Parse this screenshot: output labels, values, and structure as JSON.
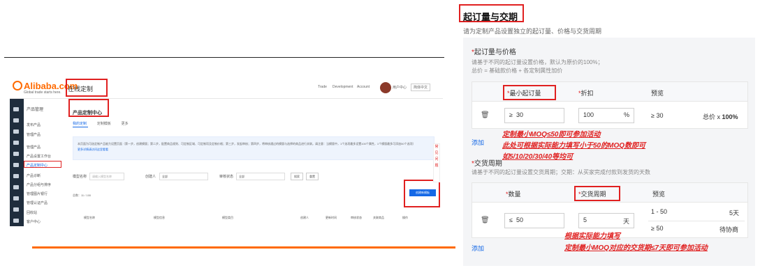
{
  "left": {
    "logo": "Alibaba.com",
    "logo_tagline": "Global trade starts here.",
    "online_custom_title": "在线定制",
    "top_nav": [
      "Trade",
      "Development",
      "Account"
    ],
    "avatar_label": "用户中心",
    "language": "简体中文",
    "menu": [
      "产品管理",
      "发布产品",
      "管理产品",
      "管理产品",
      "产品设置工作台",
      "产品定制中心",
      "产品诊断",
      "产品分组与排序",
      "管理图片银行",
      "管理认证产品",
      "回收站",
      "客户中心"
    ],
    "page_title": "产品定制中心",
    "tabs": [
      "我的定制",
      "定制模板",
      "更多"
    ],
    "info_text": "本页面为可选定制产品能力设置页面（第一步，创建模版；第二步，配置商品规则、可定制区域、可定制项及定制价格；第三步，发起审核；第四步，将审核通过的模版与选择的商品进行关联。请注意：当模版中，1个选项最多设置100个属性，1个模版最多可添加50个选项）",
    "info_link": "更多详情请访问这里看看",
    "filters": {
      "name_label": "模型名称",
      "name_placeholder": "请输入模型名称",
      "creator_label": "创建人",
      "creator_value": "全部",
      "status_label": "审核状态",
      "status_value": "全部",
      "search_button": "搜索",
      "reset_button": "重置"
    },
    "count": "总数：11 / 100",
    "create_button": "创建新模板",
    "table_headers": [
      "模型名称",
      "模型信息",
      "模型类目",
      "创建人",
      "更新时间",
      "审核状态",
      "关联商品",
      "操作"
    ],
    "side_float": [
      "常",
      "见",
      "问",
      "题"
    ]
  },
  "right": {
    "title": "起订量与交期",
    "subtitle": "请为定制产品设置独立的起订量、价格与交货周期",
    "moq_section": {
      "title": "起订量与价格",
      "hint_line1": "请基于不同的起订量设置价格，默认为原价的100%；",
      "hint_line2": "总价 = 基础款价格 + 各定制属性加价",
      "headers": [
        "最小起订量",
        "折扣",
        "预览"
      ],
      "row": {
        "prefix": "≥",
        "moq_value": "30",
        "discount_value": "100",
        "discount_suffix": "%",
        "preview_left": "≥ 30",
        "preview_right_prefix": "总价 x ",
        "preview_right_value": "100%"
      },
      "add_link": "添加"
    },
    "lead_section": {
      "title": "交货周期",
      "hint": "请基于不同的起订量设置交货周期；交期：从买家完成付款到发货的天数",
      "headers": [
        "数量",
        "交货周期",
        "预览"
      ],
      "row": {
        "prefix": "≤",
        "qty_value": "50",
        "days_value": "5",
        "days_suffix": "天",
        "preview_rows": [
          {
            "left": "1 - 50",
            "right": "5天"
          },
          {
            "left": "≥ 50",
            "right": "待协商"
          }
        ]
      },
      "add_link": "添加"
    },
    "annotations": {
      "moq_line1": "定制最小MOQ≤50即可参加活动",
      "moq_line2": "此处可根据实际能力填写小于50的MOQ数即可",
      "moq_line3": "如5/10/20/30/40等均可",
      "lead_line1": "根据实际能力填写",
      "lead_line2": "定制最小MOQ对应的交货期≤7天即可参加活动"
    }
  },
  "colors": {
    "accent": "#e02020",
    "brand_orange": "#ff6a00",
    "link_blue": "#1468e6"
  }
}
